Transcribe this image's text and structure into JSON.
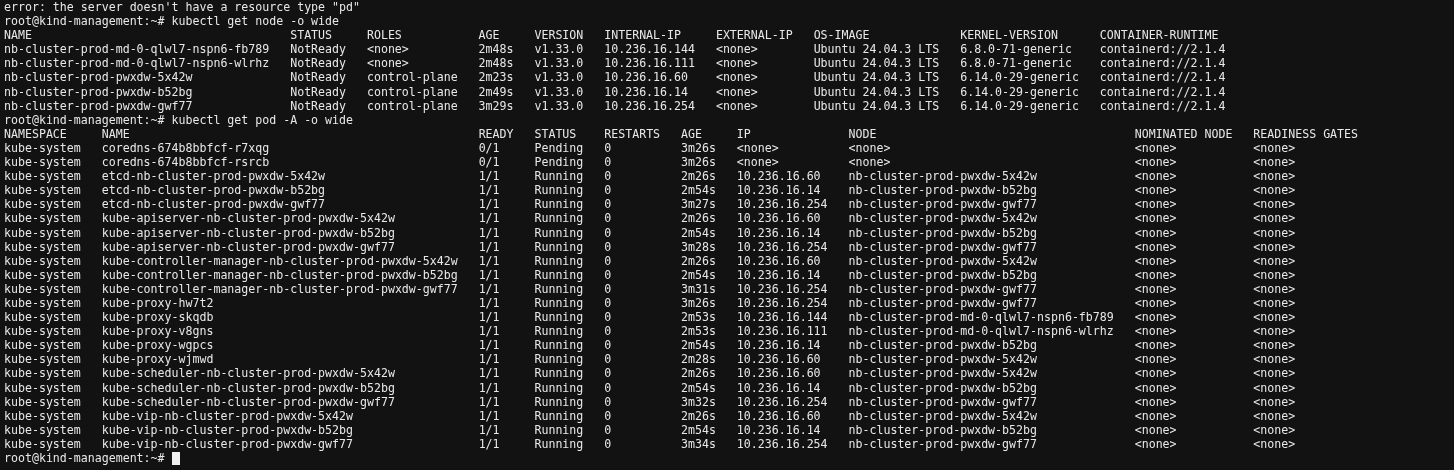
{
  "terminal": {
    "blocks": [
      {
        "kind": "output",
        "text": "error: the server doesn't have a resource type \"pd\""
      },
      {
        "kind": "prompt",
        "text": "root@kind-management:~# kubectl get node -o wide",
        "cursor": false
      },
      {
        "kind": "table",
        "columns": [
          "NAME",
          "STATUS",
          "ROLES",
          "AGE",
          "VERSION",
          "INTERNAL-IP",
          "EXTERNAL-IP",
          "OS-IMAGE",
          "KERNEL-VERSION",
          "CONTAINER-RUNTIME"
        ],
        "rows": [
          [
            "nb-cluster-prod-md-0-qlwl7-nspn6-fb789",
            "NotReady",
            "<none>",
            "2m48s",
            "v1.33.0",
            "10.236.16.144",
            "<none>",
            "Ubuntu 24.04.3 LTS",
            "6.8.0-71-generic",
            "containerd://2.1.4"
          ],
          [
            "nb-cluster-prod-md-0-qlwl7-nspn6-wlrhz",
            "NotReady",
            "<none>",
            "2m48s",
            "v1.33.0",
            "10.236.16.111",
            "<none>",
            "Ubuntu 24.04.3 LTS",
            "6.8.0-71-generic",
            "containerd://2.1.4"
          ],
          [
            "nb-cluster-prod-pwxdw-5x42w",
            "NotReady",
            "control-plane",
            "2m23s",
            "v1.33.0",
            "10.236.16.60",
            "<none>",
            "Ubuntu 24.04.3 LTS",
            "6.14.0-29-generic",
            "containerd://2.1.4"
          ],
          [
            "nb-cluster-prod-pwxdw-b52bg",
            "NotReady",
            "control-plane",
            "2m49s",
            "v1.33.0",
            "10.236.16.14",
            "<none>",
            "Ubuntu 24.04.3 LTS",
            "6.14.0-29-generic",
            "containerd://2.1.4"
          ],
          [
            "nb-cluster-prod-pwxdw-gwf77",
            "NotReady",
            "control-plane",
            "3m29s",
            "v1.33.0",
            "10.236.16.254",
            "<none>",
            "Ubuntu 24.04.3 LTS",
            "6.14.0-29-generic",
            "containerd://2.1.4"
          ]
        ]
      },
      {
        "kind": "prompt",
        "text": "root@kind-management:~# kubectl get pod -A -o wide",
        "cursor": false
      },
      {
        "kind": "table",
        "columns": [
          "NAMESPACE",
          "NAME",
          "READY",
          "STATUS",
          "RESTARTS",
          "AGE",
          "IP",
          "NODE",
          "NOMINATED NODE",
          "READINESS GATES"
        ],
        "rows": [
          [
            "kube-system",
            "coredns-674b8bbfcf-r7xqg",
            "0/1",
            "Pending",
            "0",
            "3m26s",
            "<none>",
            "<none>",
            "<none>",
            "<none>"
          ],
          [
            "kube-system",
            "coredns-674b8bbfcf-rsrcb",
            "0/1",
            "Pending",
            "0",
            "3m26s",
            "<none>",
            "<none>",
            "<none>",
            "<none>"
          ],
          [
            "kube-system",
            "etcd-nb-cluster-prod-pwxdw-5x42w",
            "1/1",
            "Running",
            "0",
            "2m26s",
            "10.236.16.60",
            "nb-cluster-prod-pwxdw-5x42w",
            "<none>",
            "<none>"
          ],
          [
            "kube-system",
            "etcd-nb-cluster-prod-pwxdw-b52bg",
            "1/1",
            "Running",
            "0",
            "2m54s",
            "10.236.16.14",
            "nb-cluster-prod-pwxdw-b52bg",
            "<none>",
            "<none>"
          ],
          [
            "kube-system",
            "etcd-nb-cluster-prod-pwxdw-gwf77",
            "1/1",
            "Running",
            "0",
            "3m27s",
            "10.236.16.254",
            "nb-cluster-prod-pwxdw-gwf77",
            "<none>",
            "<none>"
          ],
          [
            "kube-system",
            "kube-apiserver-nb-cluster-prod-pwxdw-5x42w",
            "1/1",
            "Running",
            "0",
            "2m26s",
            "10.236.16.60",
            "nb-cluster-prod-pwxdw-5x42w",
            "<none>",
            "<none>"
          ],
          [
            "kube-system",
            "kube-apiserver-nb-cluster-prod-pwxdw-b52bg",
            "1/1",
            "Running",
            "0",
            "2m54s",
            "10.236.16.14",
            "nb-cluster-prod-pwxdw-b52bg",
            "<none>",
            "<none>"
          ],
          [
            "kube-system",
            "kube-apiserver-nb-cluster-prod-pwxdw-gwf77",
            "1/1",
            "Running",
            "0",
            "3m28s",
            "10.236.16.254",
            "nb-cluster-prod-pwxdw-gwf77",
            "<none>",
            "<none>"
          ],
          [
            "kube-system",
            "kube-controller-manager-nb-cluster-prod-pwxdw-5x42w",
            "1/1",
            "Running",
            "0",
            "2m26s",
            "10.236.16.60",
            "nb-cluster-prod-pwxdw-5x42w",
            "<none>",
            "<none>"
          ],
          [
            "kube-system",
            "kube-controller-manager-nb-cluster-prod-pwxdw-b52bg",
            "1/1",
            "Running",
            "0",
            "2m54s",
            "10.236.16.14",
            "nb-cluster-prod-pwxdw-b52bg",
            "<none>",
            "<none>"
          ],
          [
            "kube-system",
            "kube-controller-manager-nb-cluster-prod-pwxdw-gwf77",
            "1/1",
            "Running",
            "0",
            "3m31s",
            "10.236.16.254",
            "nb-cluster-prod-pwxdw-gwf77",
            "<none>",
            "<none>"
          ],
          [
            "kube-system",
            "kube-proxy-hw7t2",
            "1/1",
            "Running",
            "0",
            "3m26s",
            "10.236.16.254",
            "nb-cluster-prod-pwxdw-gwf77",
            "<none>",
            "<none>"
          ],
          [
            "kube-system",
            "kube-proxy-skqdb",
            "1/1",
            "Running",
            "0",
            "2m53s",
            "10.236.16.144",
            "nb-cluster-prod-md-0-qlwl7-nspn6-fb789",
            "<none>",
            "<none>"
          ],
          [
            "kube-system",
            "kube-proxy-v8gns",
            "1/1",
            "Running",
            "0",
            "2m53s",
            "10.236.16.111",
            "nb-cluster-prod-md-0-qlwl7-nspn6-wlrhz",
            "<none>",
            "<none>"
          ],
          [
            "kube-system",
            "kube-proxy-wgpcs",
            "1/1",
            "Running",
            "0",
            "2m54s",
            "10.236.16.14",
            "nb-cluster-prod-pwxdw-b52bg",
            "<none>",
            "<none>"
          ],
          [
            "kube-system",
            "kube-proxy-wjmwd",
            "1/1",
            "Running",
            "0",
            "2m28s",
            "10.236.16.60",
            "nb-cluster-prod-pwxdw-5x42w",
            "<none>",
            "<none>"
          ],
          [
            "kube-system",
            "kube-scheduler-nb-cluster-prod-pwxdw-5x42w",
            "1/1",
            "Running",
            "0",
            "2m26s",
            "10.236.16.60",
            "nb-cluster-prod-pwxdw-5x42w",
            "<none>",
            "<none>"
          ],
          [
            "kube-system",
            "kube-scheduler-nb-cluster-prod-pwxdw-b52bg",
            "1/1",
            "Running",
            "0",
            "2m54s",
            "10.236.16.14",
            "nb-cluster-prod-pwxdw-b52bg",
            "<none>",
            "<none>"
          ],
          [
            "kube-system",
            "kube-scheduler-nb-cluster-prod-pwxdw-gwf77",
            "1/1",
            "Running",
            "0",
            "3m32s",
            "10.236.16.254",
            "nb-cluster-prod-pwxdw-gwf77",
            "<none>",
            "<none>"
          ],
          [
            "kube-system",
            "kube-vip-nb-cluster-prod-pwxdw-5x42w",
            "1/1",
            "Running",
            "0",
            "2m26s",
            "10.236.16.60",
            "nb-cluster-prod-pwxdw-5x42w",
            "<none>",
            "<none>"
          ],
          [
            "kube-system",
            "kube-vip-nb-cluster-prod-pwxdw-b52bg",
            "1/1",
            "Running",
            "0",
            "2m54s",
            "10.236.16.14",
            "nb-cluster-prod-pwxdw-b52bg",
            "<none>",
            "<none>"
          ],
          [
            "kube-system",
            "kube-vip-nb-cluster-prod-pwxdw-gwf77",
            "1/1",
            "Running",
            "0",
            "3m34s",
            "10.236.16.254",
            "nb-cluster-prod-pwxdw-gwf77",
            "<none>",
            "<none>"
          ]
        ]
      },
      {
        "kind": "prompt",
        "text": "root@kind-management:~#",
        "cursor": true
      }
    ]
  }
}
